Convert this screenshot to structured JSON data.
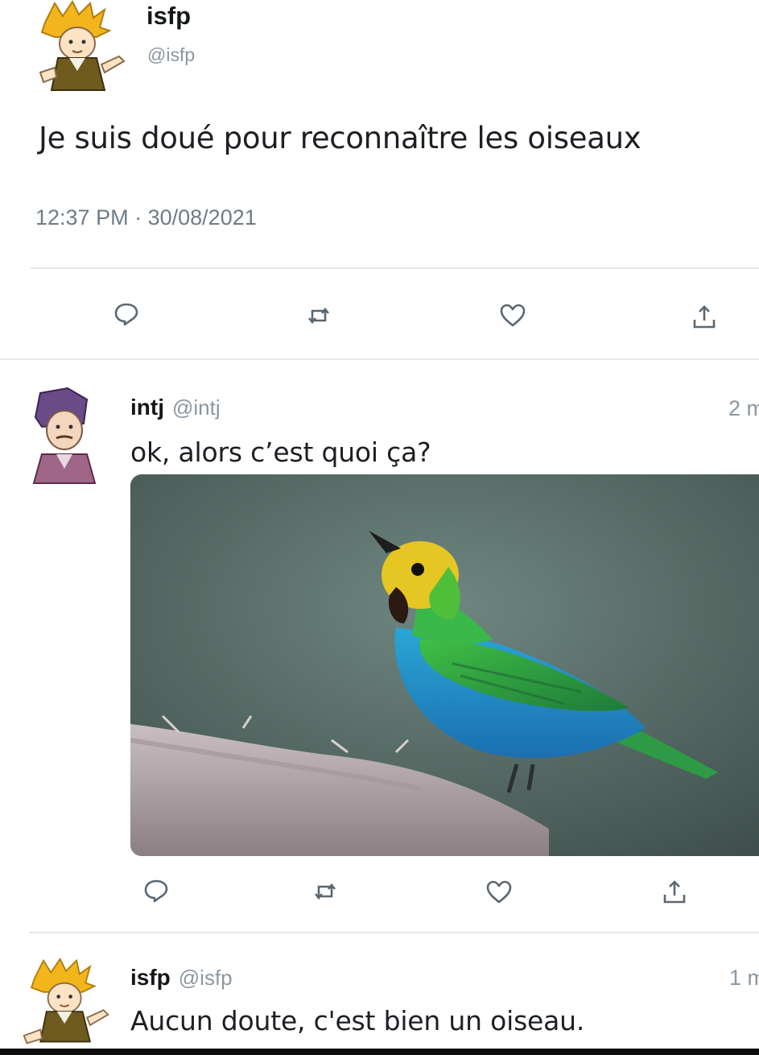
{
  "main_tweet": {
    "display_name": "isfp",
    "handle": "@isfp",
    "text": "Je suis doué pour reconnaître les oiseaux",
    "time": "12:37 PM",
    "separator": "·",
    "date": "30/08/2021",
    "avatar_icon": "cartoon-blond-avatar",
    "actions": [
      "reply-icon",
      "retweet-icon",
      "like-icon",
      "share-icon"
    ]
  },
  "replies": [
    {
      "display_name": "intj",
      "handle": "@intj",
      "time": "2 m",
      "text": "ok, alors c’est quoi ça?",
      "avatar_icon": "cartoon-purple-hair-avatar",
      "has_media": true,
      "media_icon": "bird-photo"
    },
    {
      "display_name": "isfp",
      "handle": "@isfp",
      "time": "1 m",
      "text": "Aucun doute, c'est bien un oiseau.",
      "avatar_icon": "cartoon-blond-avatar"
    }
  ],
  "colors": {
    "primary_text": "#14171a",
    "secondary_text": "#8b97a1",
    "divider": "#e2e7ec",
    "icon": "#5b6772"
  }
}
